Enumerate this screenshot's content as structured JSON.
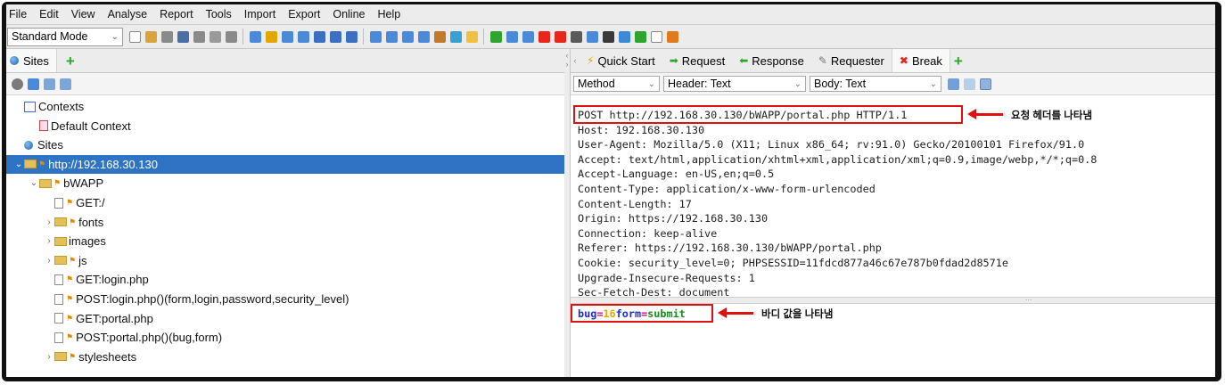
{
  "menu": [
    "File",
    "Edit",
    "View",
    "Analyse",
    "Report",
    "Tools",
    "Import",
    "Export",
    "Online",
    "Help"
  ],
  "toolbar": {
    "mode": "Standard Mode"
  },
  "sites_panel": {
    "tab_label": "Sites",
    "tree": [
      {
        "label": "Contexts",
        "depth": 0,
        "kind": "contexts",
        "arrow": ""
      },
      {
        "label": "Default Context",
        "depth": 1,
        "kind": "context",
        "arrow": ""
      },
      {
        "label": "Sites",
        "depth": 0,
        "kind": "globe",
        "arrow": ""
      },
      {
        "label": "http://192.168.30.130",
        "depth": 0,
        "kind": "folder",
        "arrow": "⌄",
        "selected": true
      },
      {
        "label": "bWAPP",
        "depth": 1,
        "kind": "folder",
        "arrow": "⌄"
      },
      {
        "label": "GET:/",
        "depth": 2,
        "kind": "doc",
        "arrow": ""
      },
      {
        "label": "fonts",
        "depth": 2,
        "kind": "folder",
        "arrow": "›"
      },
      {
        "label": "images",
        "depth": 2,
        "kind": "folder-plain",
        "arrow": "›"
      },
      {
        "label": "js",
        "depth": 2,
        "kind": "folder",
        "arrow": "›"
      },
      {
        "label": "GET:login.php",
        "depth": 2,
        "kind": "doc",
        "arrow": ""
      },
      {
        "label": "POST:login.php()(form,login,password,security_level)",
        "depth": 2,
        "kind": "doc",
        "arrow": ""
      },
      {
        "label": "GET:portal.php",
        "depth": 2,
        "kind": "doc",
        "arrow": ""
      },
      {
        "label": "POST:portal.php()(bug,form)",
        "depth": 2,
        "kind": "doc",
        "arrow": ""
      },
      {
        "label": "stylesheets",
        "depth": 2,
        "kind": "folder",
        "arrow": "›"
      }
    ]
  },
  "work_tabs": [
    {
      "label": "Quick Start",
      "icon": "⚡",
      "color": "#e0a800"
    },
    {
      "label": "Request",
      "icon": "➡",
      "color": "#2ea52e"
    },
    {
      "label": "Response",
      "icon": "⬅",
      "color": "#2ea52e"
    },
    {
      "label": "Requester",
      "icon": "✎",
      "color": "#777777"
    },
    {
      "label": "Break",
      "icon": "✖",
      "color": "#e8261b",
      "active": true
    }
  ],
  "selectors": {
    "method": "Method",
    "header": "Header: Text",
    "body": "Body: Text"
  },
  "request_lines": [
    "POST http://192.168.30.130/bWAPP/portal.php HTTP/1.1",
    "Host: 192.168.30.130",
    "User-Agent: Mozilla/5.0 (X11; Linux x86_64; rv:91.0) Gecko/20100101 Firefox/91.0",
    "Accept: text/html,application/xhtml+xml,application/xml;q=0.9,image/webp,*/*;q=0.8",
    "Accept-Language: en-US,en;q=0.5",
    "Content-Type: application/x-www-form-urlencoded",
    "Content-Length: 17",
    "Origin: https://192.168.30.130",
    "Connection: keep-alive",
    "Referer: https://192.168.30.130/bWAPP/portal.php",
    "Cookie: security_level=0; PHPSESSID=11fdcd877a46c67e787b0fdad2d8571e",
    "Upgrade-Insecure-Requests: 1",
    "Sec-Fetch-Dest: document"
  ],
  "body": {
    "parts": [
      {
        "text": "bug",
        "color": "#1a2bd6"
      },
      {
        "text": "=",
        "color": "#d10e8a"
      },
      {
        "text": "16",
        "color": "#e8a400"
      },
      {
        "text": "form",
        "color": "#1a2bd6"
      },
      {
        "text": "=",
        "color": "#d10e8a"
      },
      {
        "text": "submit",
        "color": "#1a8a1a"
      }
    ]
  },
  "annotations": {
    "header": "요청 헤더를 나타냄",
    "body": "바디 값을 나타냄"
  },
  "colors": {
    "annotation": "#e01010",
    "selection": "#2f73c4"
  }
}
